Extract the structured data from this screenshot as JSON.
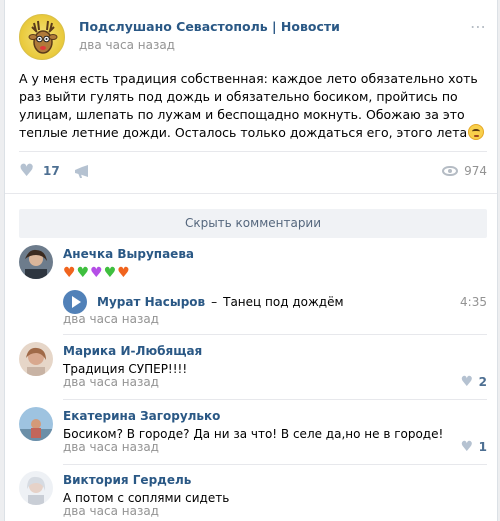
{
  "post": {
    "group_name": "Подслушано Севастополь | Новости",
    "time": "два часа назад",
    "text": "А у меня есть традиция собственная: каждое лето обязательно хоть раз выйти гулять под дождь и обязательно босиком, пройтись по улицам, шлепать по лужам и беспощадно мокнуть. Обожаю за это теплые летние дожди. Осталось только дождаться его, этого лета",
    "likes": "17",
    "views": "974"
  },
  "comments_toggle": "Скрыть комментарии",
  "comments": [
    {
      "author": "Анечка Вырупаева",
      "hearts": [
        "#f0641e",
        "#3fbf3f",
        "#b44ee6",
        "#3fbf3f",
        "#f0641e"
      ],
      "audio": {
        "artist": "Мурат Насыров",
        "dash": "–",
        "title": "Танец под дождём",
        "duration": "4:35"
      },
      "time": "два часа назад"
    },
    {
      "author": "Марика И-Любящая",
      "text": "Традиция СУПЕР!!!!",
      "time": "два часа назад",
      "likes": "2"
    },
    {
      "author": "Екатерина Загорулько",
      "text": "Босиком? В городе? Да ни за что! В селе да,но не в городе!",
      "time": "два часа назад",
      "likes": "1"
    },
    {
      "author": "Виктория Гердель",
      "text": "А потом с соплями сидеть",
      "time": "два часа назад"
    }
  ],
  "icons": {
    "more": "more-dots-icon",
    "like": "heart-icon",
    "share": "megaphone-icon",
    "views": "eye-icon",
    "play": "play-icon"
  },
  "colors": {
    "link": "#2a5885",
    "muted": "#939393",
    "accent": "#5181b8"
  }
}
